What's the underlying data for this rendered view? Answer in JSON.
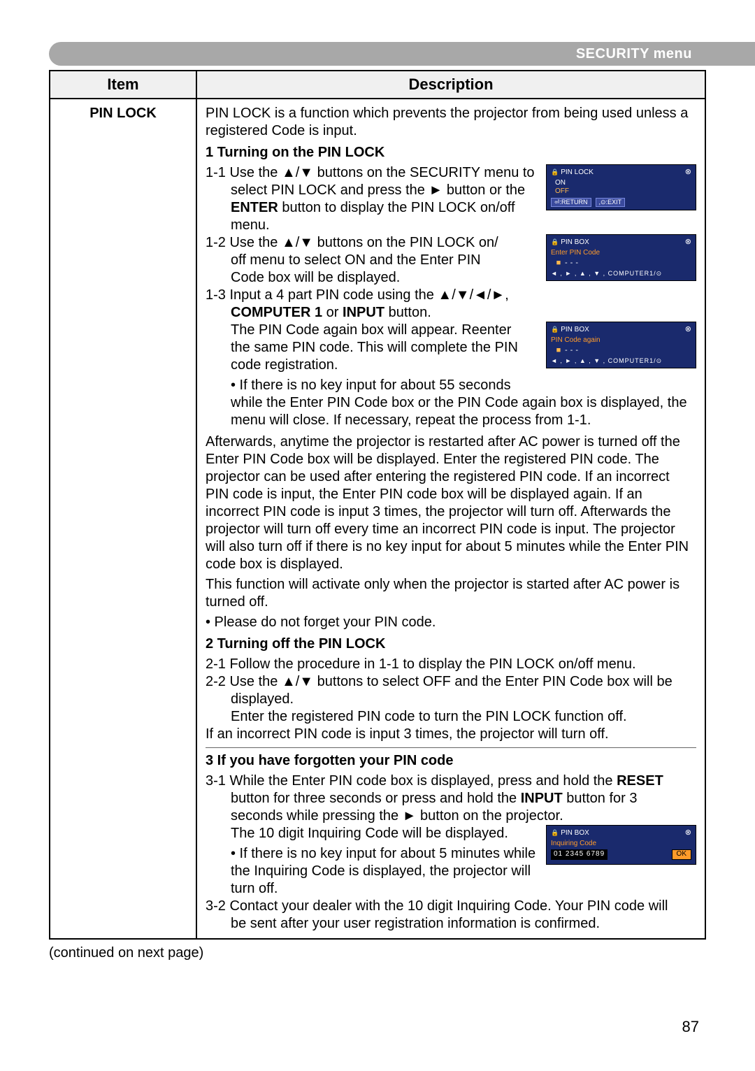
{
  "header": {
    "title": "SECURITY menu"
  },
  "table": {
    "col_item": "Item",
    "col_desc": "Description",
    "item_label": "PIN LOCK"
  },
  "desc": {
    "intro": "PIN LOCK is a function which prevents the projector from being used unless a registered Code is input.",
    "sec1_title": "1 Turning on the PIN LOCK",
    "s1_1a": "1-1 Use the ▲/▼ buttons on the SECURITY menu to",
    "s1_1b": "select PIN LOCK and press the ► button or the",
    "s1_1c": "ENTER button to display the PIN LOCK on/off",
    "s1_1d": "menu.",
    "s1_2a": "1-2 Use the ▲/▼ buttons on the PIN LOCK on/",
    "s1_2b": "off menu to select ON and the Enter PIN",
    "s1_2c": "Code box will be displayed.",
    "s1_3a": "1-3 Input a 4 part PIN code using the ▲/▼/◄/►,",
    "s1_3b": "COMPUTER 1 or INPUT button.",
    "s1_3c": "The PIN Code again box will appear. Reenter",
    "s1_3d": "the same PIN code. This will complete the PIN",
    "s1_3e": "code registration.",
    "s1_note1": "• If there is no key input for about 55 seconds",
    "s1_note1b": "while the Enter PIN Code box or the PIN Code again box is displayed, the menu will close. If necessary, repeat the process from 1-1.",
    "para2": "Afterwards, anytime the projector is restarted after AC power  is turned off the Enter PIN Code box will be displayed. Enter the registered PIN code. The projector can be used after entering the registered PIN code. If an incorrect PIN code is input, the Enter PIN code box will be displayed again. If an incorrect PIN code is input 3 times, the projector will turn off. Afterwards the projector will turn off every time an incorrect PIN code is input. The projector will also turn off if there is no key input for about 5 minutes while the Enter PIN code box is displayed.",
    "para3": "This function will activate only when the projector is started after AC power is turned off.",
    "para4": "• Please do not forget your PIN code.",
    "sec2_title": "2 Turning off the PIN LOCK",
    "s2_1": "2-1 Follow the procedure in 1-1 to display the PIN LOCK on/off menu.",
    "s2_2a": "2-2 Use the ▲/▼ buttons to select OFF and the Enter PIN Code box will be",
    "s2_2b": "displayed.",
    "s2_2c": "Enter the registered PIN code to turn the PIN LOCK function off.",
    "s2_3": "If an incorrect PIN code is input 3 times, the projector will turn off.",
    "sec3_title": "3 If you have forgotten your PIN code",
    "s3_1a": "3-1 While the Enter PIN code box is displayed, press and hold the RESET",
    "s3_1b": "button for three seconds or press and hold the INPUT button for 3",
    "s3_1c": "seconds while pressing the ► button on the projector.",
    "s3_1d": "The 10 digit Inquiring Code will be displayed.",
    "s3_note": "• If there is no key input for about 5 minutes while the Inquiring Code is displayed, the projector will turn off.",
    "s3_2a": "3-2 Contact your dealer with the 10 digit Inquiring Code. Your PIN code will",
    "s3_2b": "be sent after your user registration information is confirmed."
  },
  "osd": {
    "pinlock_title": "PIN LOCK",
    "on": "ON",
    "off": "OFF",
    "return": "⏎:RETURN",
    "exit": ",⊙:EXIT",
    "pinbox_title": "PIN BOX",
    "enter_pin": "Enter PIN Code",
    "code_again": "PIN Code again",
    "nav": "◄ , ► , ▲ , ▼ , COMPUTER1/⊙",
    "inquiring": "Inquiring Code",
    "inq_code": "01 2345 6789",
    "ok": "OK"
  },
  "footer": {
    "continued": "(continued on next page)",
    "page": "87"
  }
}
